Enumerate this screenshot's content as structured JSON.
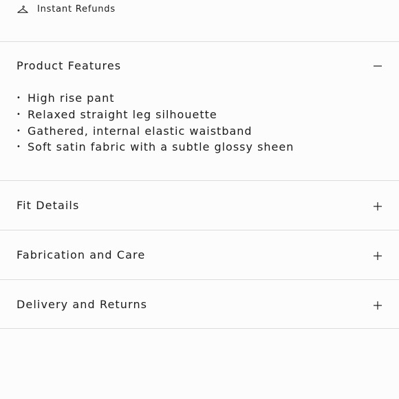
{
  "refund_row": {
    "label": "Instant Refunds",
    "icon": "hanger-icon"
  },
  "accordions": [
    {
      "title": "Product Features",
      "state": "expanded",
      "toggle_icon": "minus-icon",
      "bullet": "•",
      "items": [
        "High rise pant",
        "Relaxed straight leg silhouette",
        "Gathered, internal elastic waistband",
        "Soft satin fabric with a subtle glossy sheen"
      ]
    },
    {
      "title": "Fit Details",
      "state": "collapsed",
      "toggle_icon": "plus-icon"
    },
    {
      "title": "Fabrication and Care",
      "state": "collapsed",
      "toggle_icon": "plus-icon"
    },
    {
      "title": "Delivery and Returns",
      "state": "collapsed",
      "toggle_icon": "plus-icon"
    }
  ],
  "colors": {
    "background": "#fcfcfc",
    "text": "#1b1b1b",
    "divider": "#dcdcdc"
  }
}
